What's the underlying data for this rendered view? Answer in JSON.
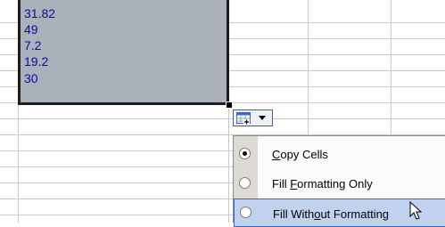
{
  "cells": [
    "31.82",
    "49",
    "7.2",
    "19.2",
    "30"
  ],
  "smart_tag": {
    "icon": "paste-options-icon",
    "arrow": "dropdown-arrow-icon"
  },
  "menu": {
    "items": [
      {
        "pre": "",
        "key": "C",
        "post": "opy Cells",
        "selected": true
      },
      {
        "pre": "Fill ",
        "key": "F",
        "post": "ormatting Only",
        "selected": false
      },
      {
        "pre": "Fill With",
        "key": "o",
        "post": "ut Formatting",
        "selected": false
      }
    ]
  },
  "colors": {
    "selection": "#abb1ba",
    "cell_text": "#0a0aa0",
    "menu_hover": "#c1d2ee",
    "menu_strip": "#dcdad3"
  }
}
